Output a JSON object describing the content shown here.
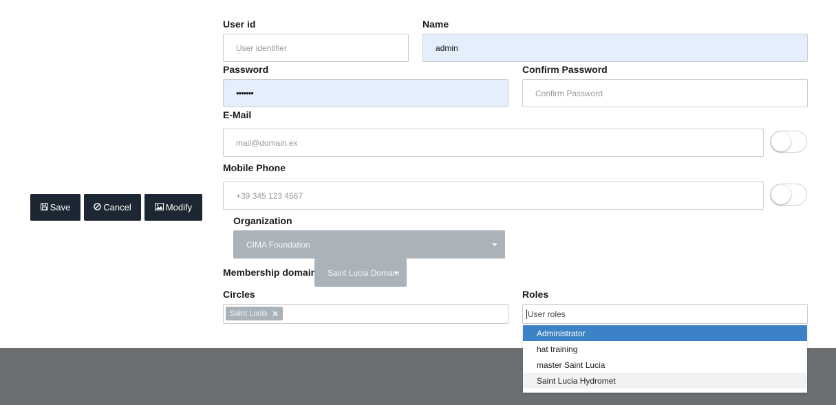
{
  "form": {
    "user_id": {
      "label": "User id",
      "placeholder": "User identifier",
      "value": ""
    },
    "name": {
      "label": "Name",
      "value": "admin"
    },
    "password": {
      "label": "Password",
      "value": "•••••••"
    },
    "confirm_password": {
      "label": "Confirm Password",
      "placeholder": "Confirm Password"
    },
    "email": {
      "label": "E-Mail",
      "placeholder": "mail@domain.ex",
      "toggle_on": false
    },
    "mobile": {
      "label": "Mobile Phone",
      "placeholder": "+39 345 123 4567",
      "toggle_on": false
    },
    "organization": {
      "label": "Organization",
      "selected": "CIMA Foundation"
    },
    "membership_domain": {
      "label": "Membership domain",
      "selected": "Saint Lucia Domain"
    },
    "circles": {
      "label": "Circles",
      "tags": [
        "Saint Lucia"
      ]
    },
    "roles": {
      "label": "Roles",
      "placeholder": "User roles",
      "options": [
        "Administrator",
        "hat training",
        "master Saint Lucia",
        "Saint Lucia Hydromet"
      ],
      "highlighted": "Administrator"
    }
  },
  "actions": {
    "save": "Save",
    "cancel": "Cancel",
    "modify": "Modify"
  },
  "icons": {
    "save": "floppy-disk-icon",
    "cancel": "ban-icon",
    "modify": "image-icon"
  },
  "colors": {
    "button_bg": "#1d2733",
    "filled_field_bg": "#e5eefb",
    "select_bg": "#aab3ba",
    "dropdown_active": "#3c82c6",
    "footer_bg": "#6c6f72"
  }
}
